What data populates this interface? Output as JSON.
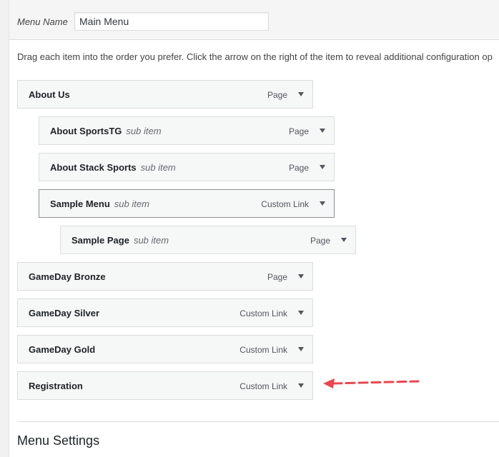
{
  "menu": {
    "name_label": "Menu Name",
    "name_value": "Main Menu"
  },
  "instructions": "Drag each item into the order you prefer. Click the arrow on the right of the item to reveal additional configuration op",
  "items": [
    {
      "title": "About Us",
      "sub": "",
      "type": "Page"
    },
    {
      "title": "About SportsTG",
      "sub": "sub item",
      "type": "Page"
    },
    {
      "title": "About Stack Sports",
      "sub": "sub item",
      "type": "Page"
    },
    {
      "title": "Sample Menu",
      "sub": "sub item",
      "type": "Custom Link"
    },
    {
      "title": "Sample Page",
      "sub": "sub item",
      "type": "Page"
    },
    {
      "title": "GameDay Bronze",
      "sub": "",
      "type": "Page"
    },
    {
      "title": "GameDay Silver",
      "sub": "",
      "type": "Custom Link"
    },
    {
      "title": "GameDay Gold",
      "sub": "",
      "type": "Custom Link"
    },
    {
      "title": "Registration",
      "sub": "",
      "type": "Custom Link"
    }
  ],
  "settings": {
    "title": "Menu Settings"
  },
  "colors": {
    "annotation_arrow": "#e8474f"
  }
}
